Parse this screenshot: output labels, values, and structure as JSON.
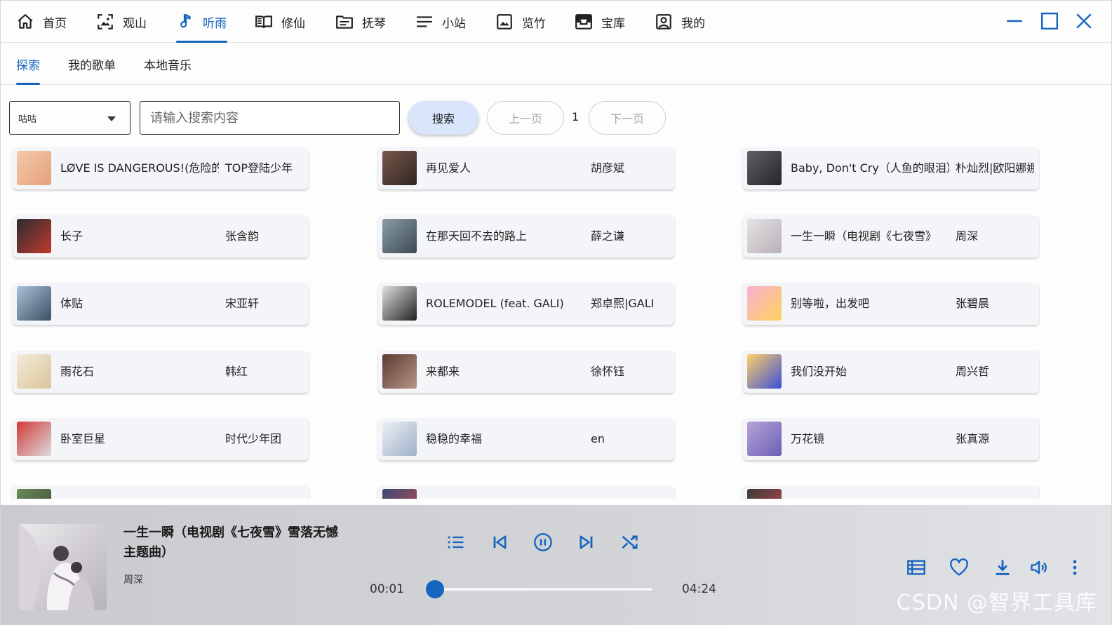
{
  "nav": {
    "items": [
      {
        "label": "首页",
        "icon": "home-icon"
      },
      {
        "label": "观山",
        "icon": "image-frame-icon"
      },
      {
        "label": "听雨",
        "icon": "music-note-icon",
        "active": true
      },
      {
        "label": "修仙",
        "icon": "book-open-icon"
      },
      {
        "label": "抚琴",
        "icon": "folder-icon"
      },
      {
        "label": "小站",
        "icon": "menu-lines-icon"
      },
      {
        "label": "览竹",
        "icon": "picture-icon"
      },
      {
        "label": "宝库",
        "icon": "archive-box-icon"
      },
      {
        "label": "我的",
        "icon": "user-portrait-icon"
      }
    ],
    "accent": "#1565c0"
  },
  "subtabs": [
    {
      "label": "探索",
      "active": true
    },
    {
      "label": "我的歌单"
    },
    {
      "label": "本地音乐"
    }
  ],
  "search": {
    "source": "咕咕",
    "placeholder": "请输入搜索内容",
    "value": "",
    "search_label": "搜索",
    "prev_label": "上一页",
    "page": "1",
    "next_label": "下一页"
  },
  "songs": [
    {
      "title": "LØVE IS DANGEROUS!(危险的爱)",
      "artist": "TOP登陆少年",
      "cover": [
        "#f3c9a9",
        "#e6a17d"
      ]
    },
    {
      "title": "再见爱人",
      "artist": "胡彦斌",
      "cover": [
        "#7a5a4c",
        "#2e2320"
      ]
    },
    {
      "title": "Baby, Don't Cry（人鱼的眼泪）",
      "artist": "朴灿烈|欧阳娜娜",
      "cover": [
        "#5f6166",
        "#24262a"
      ]
    },
    {
      "title": "长子",
      "artist": "张含韵",
      "cover": [
        "#2b2b30",
        "#c23a2e"
      ]
    },
    {
      "title": "在那天回不去的路上",
      "artist": "薛之谦",
      "cover": [
        "#8a9ca6",
        "#3c4a52"
      ]
    },
    {
      "title": "一生一瞬（电视剧《七夜雪》",
      "artist": "周深",
      "cover": [
        "#e6e2e4",
        "#b8b1b8"
      ]
    },
    {
      "title": "体贴",
      "artist": "宋亚轩",
      "cover": [
        "#a9c2d8",
        "#3d4f63"
      ]
    },
    {
      "title": "ROLEMODEL (feat. GALI)",
      "artist": "郑卓熙|GALI",
      "cover": [
        "#e0e0e0",
        "#222222"
      ]
    },
    {
      "title": "别等啦，出发吧",
      "artist": "张碧晨",
      "cover": [
        "#f7b0d2",
        "#ffd45e"
      ]
    },
    {
      "title": "雨花石",
      "artist": "韩红",
      "cover": [
        "#f3ead8",
        "#d9c59a"
      ]
    },
    {
      "title": "来都来",
      "artist": "徐怀钰",
      "cover": [
        "#5a3a30",
        "#b59686"
      ]
    },
    {
      "title": "我们没开始",
      "artist": "周兴哲",
      "cover": [
        "#ffd067",
        "#3d4fd9"
      ]
    },
    {
      "title": "卧室巨星",
      "artist": "时代少年团",
      "cover": [
        "#d23a3a",
        "#dcdcdc"
      ]
    },
    {
      "title": "稳稳的幸福",
      "artist": "en",
      "cover": [
        "#eef0f3",
        "#9cb0c8"
      ]
    },
    {
      "title": "万花镜",
      "artist": "张真源",
      "cover": [
        "#b7a3d8",
        "#6b5fb5"
      ]
    },
    {
      "title": "",
      "artist": "",
      "cover": [
        "#6b8a5a",
        "#3a4a30"
      ]
    },
    {
      "title": "",
      "artist": "",
      "cover": [
        "#3a4a7a",
        "#c24a4a"
      ]
    },
    {
      "title": "",
      "artist": "",
      "cover": [
        "#3a3a3a",
        "#c24a4a"
      ]
    }
  ],
  "player": {
    "title": "一生一瞬（电视剧《七夜雪》雪落无憾主题曲）",
    "artist": "周深",
    "current_time": "00:01",
    "total_time": "04:24",
    "progress_fraction": 0.004,
    "controls": [
      "playlist-icon",
      "skip-previous-icon",
      "pause-icon",
      "skip-next-icon",
      "shuffle-icon"
    ],
    "right_controls": [
      "queue-list-icon",
      "heart-icon",
      "download-icon",
      "volume-icon",
      "more-vert-icon"
    ]
  },
  "watermark": "CSDN @智界工具库"
}
